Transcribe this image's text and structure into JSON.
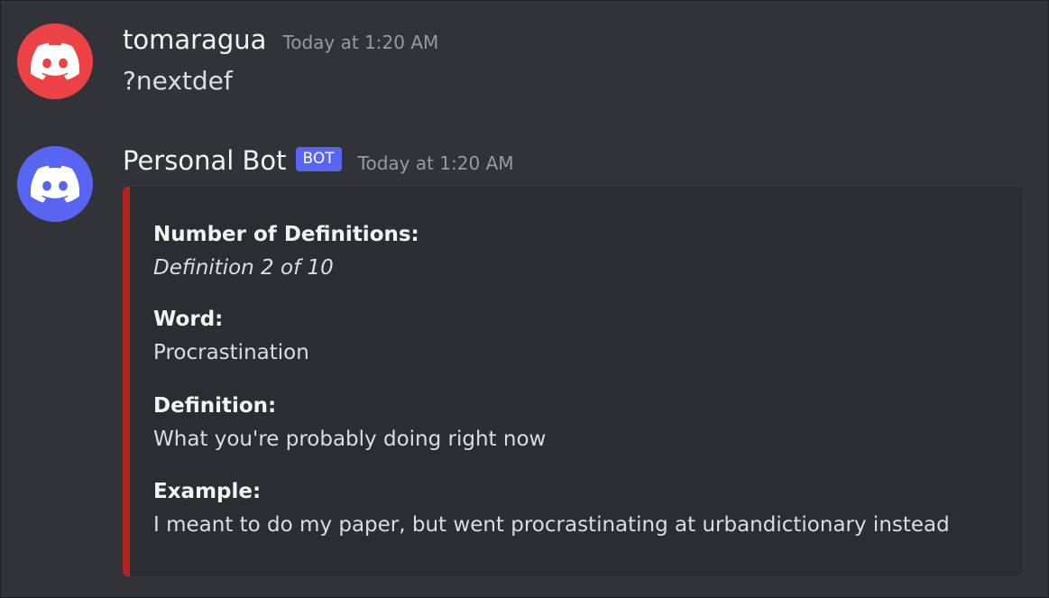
{
  "messages": [
    {
      "author": "tomaragua",
      "timestamp": "Today at 1:20 AM",
      "content": "?nextdef",
      "avatar_color": "#ed4245",
      "avatar_icon": "discord-logo-icon"
    },
    {
      "author": "Personal Bot",
      "bot_tag": "BOT",
      "timestamp": "Today at 1:20 AM",
      "avatar_color": "#5865f2",
      "avatar_icon": "discord-logo-icon",
      "embed": {
        "accent_color": "#b5231f",
        "fields": [
          {
            "name": "Number of Definitions:",
            "value": "Definition 2 of 10"
          },
          {
            "name": "Word:",
            "value": "Procrastination"
          },
          {
            "name": "Definition:",
            "value": "What you're probably doing right now"
          },
          {
            "name": "Example:",
            "value": "I meant to do my paper, but went procrastinating at urbandictionary instead"
          }
        ]
      }
    }
  ],
  "colors": {
    "background": "#313338",
    "embed_background": "#2b2d31",
    "bot_tag": "#5865f2"
  }
}
